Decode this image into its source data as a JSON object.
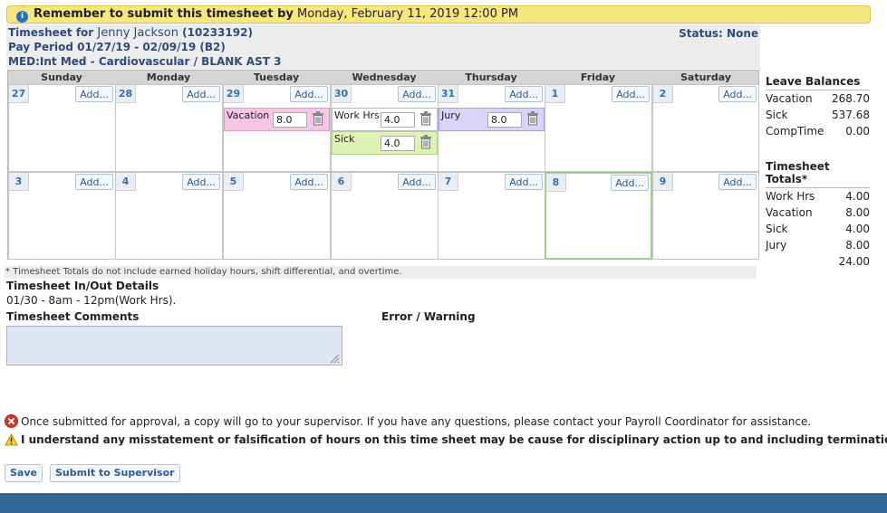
{
  "banner": {
    "prefix": "Remember to submit this timesheet by",
    "deadline": "Monday, February 11, 2019 12:00 PM"
  },
  "header": {
    "timesheet_for_label": "Timesheet for",
    "employee_name": "Jenny Jackson",
    "employee_id": "(10233192)",
    "pay_period": "Pay Period 01/27/19 - 02/09/19 (B2)",
    "department": "MED:Int Med - Cardiovascular / BLANK AST 3",
    "status": "Status: None"
  },
  "calendar": {
    "add_label": "Add...",
    "days": [
      "Sunday",
      "Monday",
      "Tuesday",
      "Wednesday",
      "Thursday",
      "Friday",
      "Saturday"
    ],
    "week1": [
      "27",
      "28",
      "29",
      "30",
      "31",
      "1",
      "2"
    ],
    "week2": [
      "3",
      "4",
      "5",
      "6",
      "7",
      "8",
      "9"
    ],
    "entries": {
      "tue_vacation": {
        "type": "Vacation",
        "hours": "8.0"
      },
      "wed_work": {
        "type": "Work Hrs",
        "hours": "4.0"
      },
      "wed_sick": {
        "type": "Sick",
        "hours": "4.0"
      },
      "thu_jury": {
        "type": "Jury",
        "hours": "8.0"
      }
    },
    "entry_colors": {
      "vacation": "#f7c6e6",
      "sick": "#dff2b6",
      "jury": "#d9d3f7"
    }
  },
  "leave_balances": {
    "title": "Leave Balances",
    "items": [
      {
        "label": "Vacation",
        "value": "268.70"
      },
      {
        "label": "Sick",
        "value": "537.68"
      },
      {
        "label": "CompTime",
        "value": "0.00"
      }
    ]
  },
  "totals": {
    "title": "Timesheet Totals*",
    "items": [
      {
        "label": "Work Hrs",
        "value": "4.00"
      },
      {
        "label": "Vacation",
        "value": "8.00"
      },
      {
        "label": "Sick",
        "value": "4.00"
      },
      {
        "label": "Jury",
        "value": "8.00"
      }
    ],
    "grand_total": "24.00"
  },
  "footnote": "* Timesheet Totals do not include earned holiday hours, shift differential, and overtime.",
  "inout": {
    "title": "Timesheet In/Out Details",
    "line": "01/30 - 8am - 12pm(Work Hrs)."
  },
  "comments": {
    "title": "Timesheet Comments",
    "value": ""
  },
  "error_warning_title": "Error / Warning",
  "notices": {
    "approval": "Once submitted for approval, a copy will go to your supervisor. If you have any questions, please contact your Payroll Coordinator for assistance.",
    "misstatement": "I understand any misstatement or falsification of hours on this time sheet may be cause for disciplinary action up to and including termination."
  },
  "buttons": {
    "save": "Save",
    "submit": "Submit to Supervisor"
  },
  "colors": {
    "banner": "#f8e77e",
    "bottom_bar": "#33679a",
    "accent": "#2f4a7d"
  }
}
